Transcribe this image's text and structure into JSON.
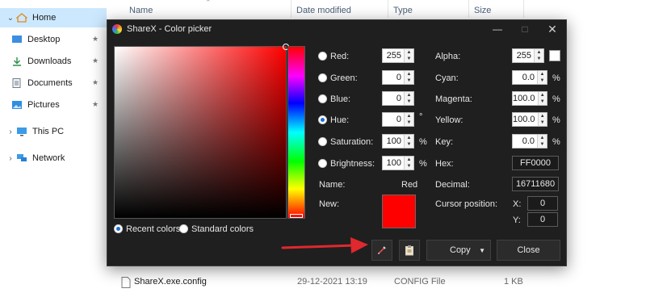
{
  "explorer": {
    "nav": [
      {
        "label": "Home",
        "icon": "home-icon"
      },
      {
        "label": "Desktop",
        "icon": "desktop-folder-icon"
      },
      {
        "label": "Downloads",
        "icon": "downloads-icon"
      },
      {
        "label": "Documents",
        "icon": "documents-icon"
      },
      {
        "label": "Pictures",
        "icon": "pictures-icon"
      },
      {
        "label": "This PC",
        "icon": "pc-icon"
      },
      {
        "label": "Network",
        "icon": "network-icon"
      }
    ],
    "columns": {
      "name": "Name",
      "date": "Date modified",
      "type": "Type",
      "size": "Size"
    },
    "file": {
      "name": "ShareX.exe.config",
      "date": "29-12-2021 13:19",
      "type": "CONFIG File",
      "size": "1 KB"
    }
  },
  "dialog": {
    "title": "ShareX - Color picker",
    "left_fields": [
      {
        "label": "Red:",
        "value": "255",
        "unit": "",
        "checked": false
      },
      {
        "label": "Green:",
        "value": "0",
        "unit": "",
        "checked": false
      },
      {
        "label": "Blue:",
        "value": "0",
        "unit": "",
        "checked": false
      },
      {
        "label": "Hue:",
        "value": "0",
        "unit": "°",
        "checked": true
      },
      {
        "label": "Saturation:",
        "value": "100",
        "unit": "%",
        "checked": false
      },
      {
        "label": "Brightness:",
        "value": "100",
        "unit": "%",
        "checked": false
      }
    ],
    "right_fields": [
      {
        "label": "Alpha:",
        "value": "255",
        "unit": ""
      },
      {
        "label": "Cyan:",
        "value": "0.0",
        "unit": "%"
      },
      {
        "label": "Magenta:",
        "value": "100.0",
        "unit": "%"
      },
      {
        "label": "Yellow:",
        "value": "100.0",
        "unit": "%"
      },
      {
        "label": "Key:",
        "value": "0.0",
        "unit": "%"
      }
    ],
    "hex_label": "Hex:",
    "hex_value": "FF0000",
    "decimal_label": "Decimal:",
    "decimal_value": "16711680",
    "name_label": "Name:",
    "name_value": "Red",
    "new_label": "New:",
    "new_color": "#ff0000",
    "cursor_label": "Cursor position:",
    "x_label": "X:",
    "x_value": "0",
    "y_label": "Y:",
    "y_value": "0",
    "palette_options": [
      {
        "label": "Recent colors",
        "checked": true
      },
      {
        "label": "Standard colors",
        "checked": false
      }
    ],
    "buttons": {
      "copy": "Copy",
      "close": "Close"
    },
    "annotation_color": "#e0282e"
  }
}
